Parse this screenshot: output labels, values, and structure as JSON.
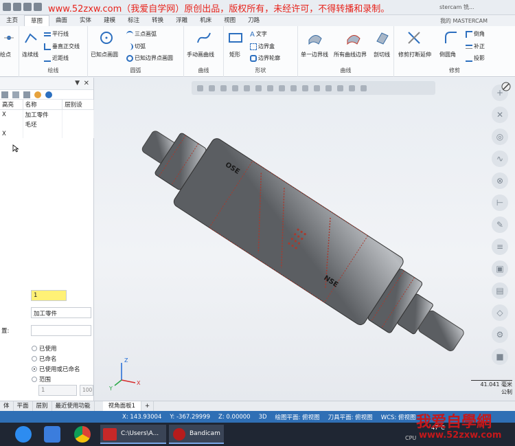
{
  "watermark": "www.52zxw.com（我爱自学网）原创出品，版权所有，未经许可，不得转播和录制。",
  "app_title": "stercam 铣...",
  "tabs": [
    "主页",
    "草图",
    "曲面",
    "实体",
    "建模",
    "标注",
    "转换",
    "浮雕",
    "机床",
    "视图",
    "刀路"
  ],
  "active_tab": "草图",
  "my_mastercam": "我的 MASTERCAM",
  "ribbon": {
    "groups": {
      "line": "绘线",
      "arc": "圆弧",
      "curve": "曲线",
      "shape": "形状",
      "curve2": "曲线",
      "trim": "修剪"
    },
    "points_label": "绘点",
    "line_items": [
      "连续线",
      "平行线",
      "垂直正交线",
      "近距线"
    ],
    "arc_items": [
      "已知点画圆",
      "三点画弧",
      "切弧",
      "已知边界点画圆"
    ],
    "curve_items": [
      "手动画曲线"
    ],
    "shape_items": [
      "矩形",
      "文字",
      "边界盒",
      "边界轮廓"
    ],
    "curve2_items": [
      "单一边界线",
      "所有曲线边界",
      "剖切线"
    ],
    "trim_items": [
      "修剪打断延伸",
      "倒圆角",
      "倒角",
      "补正",
      "投影"
    ]
  },
  "left_panel": {
    "columns": [
      "高亮",
      "名称",
      "层别设"
    ],
    "rows": [
      {
        "hl": "X",
        "name": "加工零件"
      },
      {
        "hl": "",
        "name": "毛坯"
      },
      {
        "hl": "X",
        "name": ""
      }
    ],
    "number_value": "1",
    "name_value": "加工零件",
    "label_left": "置:",
    "radios": [
      "已使用",
      "已命名",
      "已使用或已命名",
      "范围"
    ],
    "radio_selected": "已使用或已命名",
    "range_from": "1",
    "range_to": "100"
  },
  "scale": {
    "value": "41.041 毫米",
    "unit": "公制"
  },
  "bottom_tabs": [
    "体",
    "平面",
    "层别",
    "最近使用功能",
    "视角面板1",
    "+"
  ],
  "active_bottom_tab": "视角面板1",
  "status": {
    "x": "X:  143.93004",
    "y": "Y:  -367.29999",
    "z": "Z:  0.00000",
    "mode": "3D",
    "draw_plane": "绘图平面: 俯视图",
    "tool_plane": "刀具平面: 俯视图",
    "wcs": "WCS: 俯视图"
  },
  "taskbar": {
    "task1": "C:\\Users\\A...",
    "task2": "Bandicam",
    "clock1": "47°C",
    "clock2": "CPU"
  },
  "logo": {
    "big": "我爱自學網",
    "url": "www.52zxw.com"
  },
  "part_text": [
    "OSE",
    "NSE"
  ]
}
